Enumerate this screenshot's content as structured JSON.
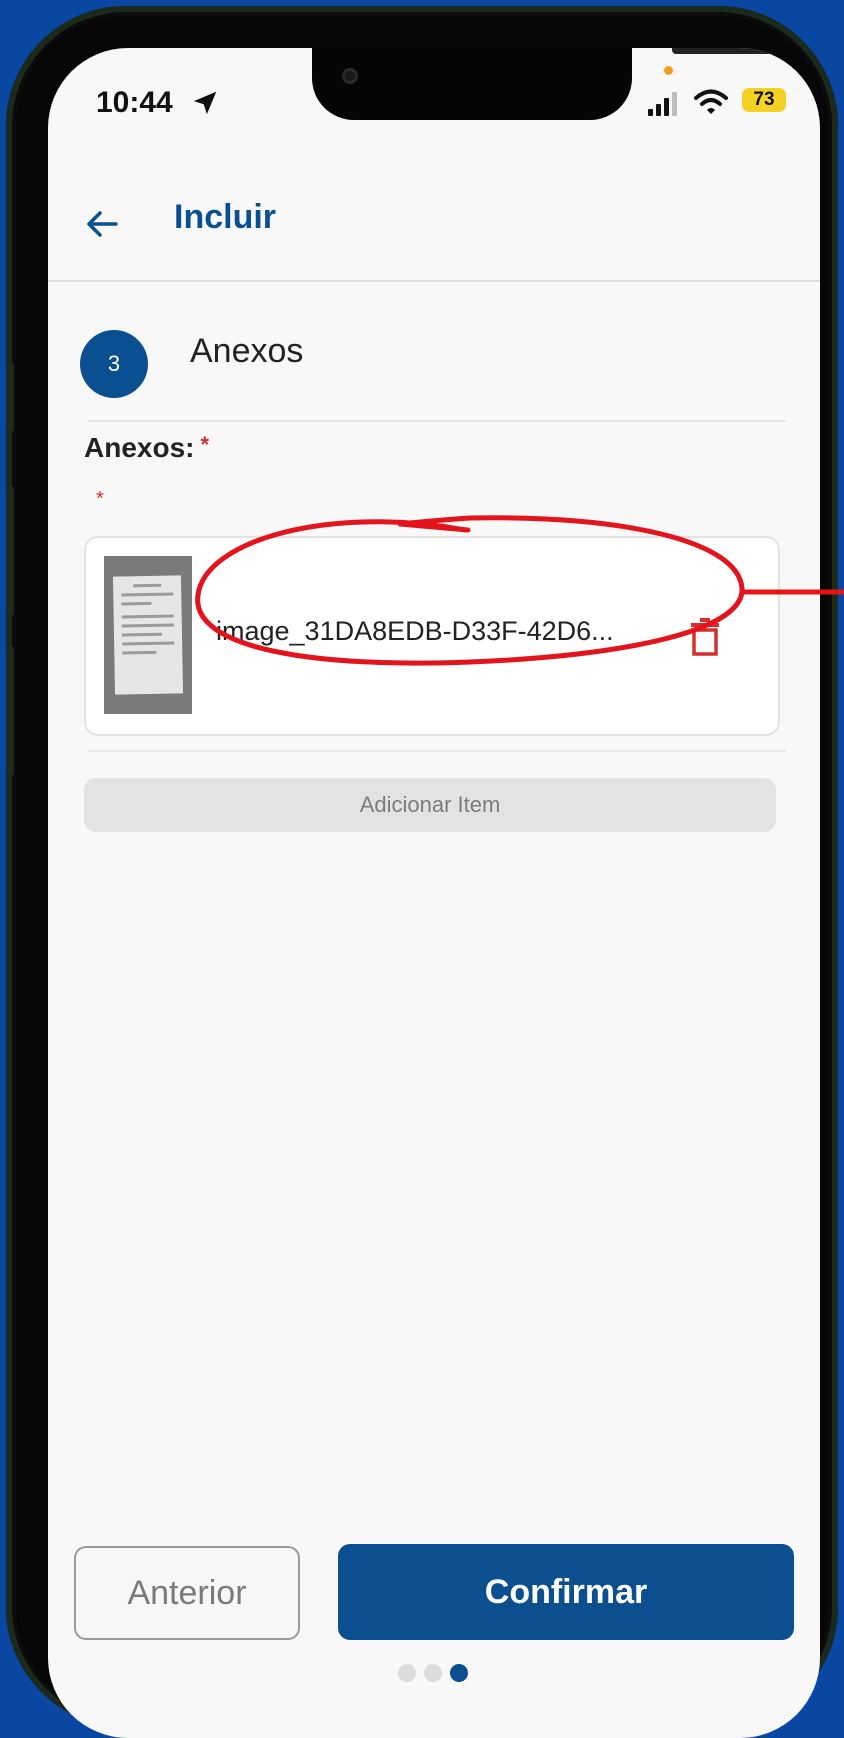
{
  "status_bar": {
    "time": "10:44",
    "battery": "73"
  },
  "header": {
    "title": "Incluir"
  },
  "step": {
    "number": "3",
    "title": "Anexos"
  },
  "field": {
    "label": "Anexos:",
    "required_mark": "*"
  },
  "attachment": {
    "file_name": "image_31DA8EDB-D33F-42D6..."
  },
  "buttons": {
    "add_item": "Adicionar Item",
    "previous": "Anterior",
    "confirm": "Confirmar"
  },
  "pagination": {
    "total": 3,
    "current": 3
  },
  "colors": {
    "primary": "#0b4f8f",
    "danger": "#d32f2f",
    "annotation": "#e3141b",
    "background": "#0a47a3"
  }
}
